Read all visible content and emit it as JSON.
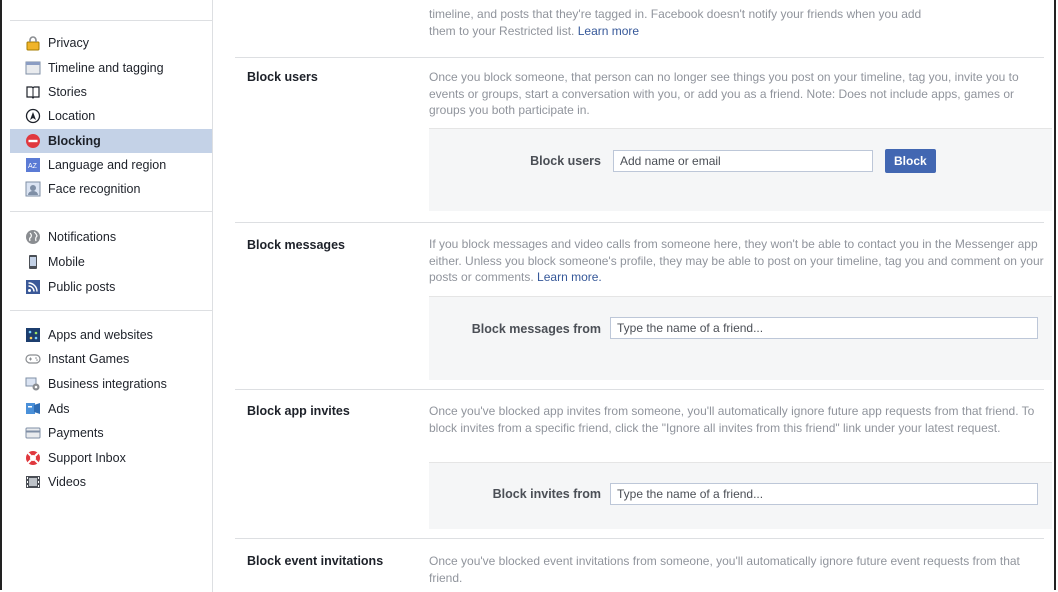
{
  "sidebar": {
    "items": [
      {
        "label": "Privacy",
        "icon": "lock-icon"
      },
      {
        "label": "Timeline and tagging",
        "icon": "timeline-icon"
      },
      {
        "label": "Stories",
        "icon": "book-icon"
      },
      {
        "label": "Location",
        "icon": "location-icon"
      },
      {
        "label": "Blocking",
        "icon": "block-icon",
        "active": true
      },
      {
        "label": "Language and region",
        "icon": "language-icon"
      },
      {
        "label": "Face recognition",
        "icon": "face-recognition-icon"
      },
      {
        "label": "Notifications",
        "icon": "globe-icon"
      },
      {
        "label": "Mobile",
        "icon": "mobile-icon"
      },
      {
        "label": "Public posts",
        "icon": "rss-icon"
      },
      {
        "label": "Apps and websites",
        "icon": "apps-icon"
      },
      {
        "label": "Instant Games",
        "icon": "gamepad-icon"
      },
      {
        "label": "Business integrations",
        "icon": "gear-icon"
      },
      {
        "label": "Ads",
        "icon": "ads-icon"
      },
      {
        "label": "Payments",
        "icon": "credit-card-icon"
      },
      {
        "label": "Support Inbox",
        "icon": "lifebuoy-icon"
      },
      {
        "label": "Videos",
        "icon": "film-icon"
      }
    ]
  },
  "restricted": {
    "desc_line2": "timeline, and posts that they're tagged in. Facebook doesn't notify your friends when you add",
    "desc_line3": "them to your Restricted list.",
    "link": "Learn more"
  },
  "block_users": {
    "title": "Block users",
    "desc": "Once you block someone, that person can no longer see things you post on your timeline, tag you, invite you to events or groups, start a conversation with you, or add you as a friend. Note: Does not include apps, games or groups you both participate in.",
    "field_label": "Block users",
    "placeholder": "Add name or email",
    "button": "Block"
  },
  "block_messages": {
    "title": "Block messages",
    "desc": "If you block messages and video calls from someone here, they won't be able to contact you in the Messenger app either. Unless you block someone's profile, they may be able to post on your timeline, tag you and comment on your posts or comments.",
    "link": "Learn more.",
    "field_label": "Block messages from",
    "placeholder": "Type the name of a friend..."
  },
  "block_app_invites": {
    "title": "Block app invites",
    "desc": "Once you've blocked app invites from someone, you'll automatically ignore future app requests from that friend. To block invites from a specific friend, click the \"Ignore all invites from this friend\" link under your latest request.",
    "field_label": "Block invites from",
    "placeholder": "Type the name of a friend..."
  },
  "block_event_invitations": {
    "title": "Block event invitations",
    "desc": "Once you've blocked event invitations from someone, you'll automatically ignore future event requests from that friend."
  },
  "colors": {
    "active_bg": "#c4d2e7",
    "link": "#365899",
    "button": "#4267b2",
    "muted_text": "#90949c",
    "panel_bg": "#f5f6f7"
  }
}
